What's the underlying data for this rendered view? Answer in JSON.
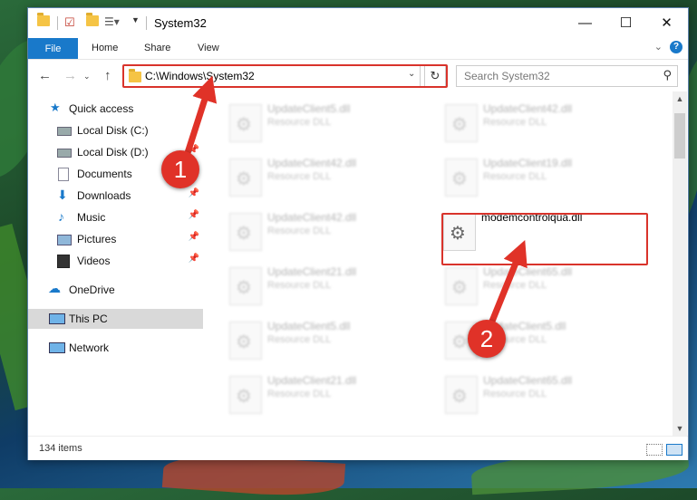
{
  "window": {
    "title": "System32",
    "controls": {
      "minimize": "—",
      "maximize": "☐",
      "close": "✕"
    }
  },
  "ribbon": {
    "tabs": [
      "File",
      "Home",
      "Share",
      "View"
    ],
    "help": "?"
  },
  "address_bar": {
    "path": "C:\\Windows\\System32",
    "search_placeholder": "Search System32"
  },
  "sidebar": {
    "items": [
      {
        "label": "Quick access",
        "icon": "star-icon",
        "pinned": false
      },
      {
        "label": "Local Disk (C:)",
        "icon": "drive-icon",
        "pinned": false
      },
      {
        "label": "Local Disk (D:)",
        "icon": "drive-icon",
        "pinned": true
      },
      {
        "label": "Documents",
        "icon": "documents-icon",
        "pinned": true
      },
      {
        "label": "Downloads",
        "icon": "download-arrow-icon",
        "pinned": true
      },
      {
        "label": "Music",
        "icon": "music-note-icon",
        "pinned": true
      },
      {
        "label": "Pictures",
        "icon": "pictures-icon",
        "pinned": true
      },
      {
        "label": "Videos",
        "icon": "film-icon",
        "pinned": true
      },
      {
        "label": "OneDrive",
        "icon": "cloud-icon",
        "pinned": false
      },
      {
        "label": "This PC",
        "icon": "monitor-icon",
        "pinned": false,
        "selected": true
      },
      {
        "label": "Network",
        "icon": "network-icon",
        "pinned": false
      }
    ]
  },
  "files": [
    {
      "name": "UpdateClient5.dll",
      "type": "Resource DLL"
    },
    {
      "name": "UpdateClient42.dll",
      "type": "Resource DLL"
    },
    {
      "name": "UpdateClient42.dll",
      "type": "Resource DLL"
    },
    {
      "name": "UpdateClient19.dll",
      "type": "Resource DLL"
    },
    {
      "name": "UpdateClient42.dll",
      "type": "Resource DLL"
    },
    {
      "name": "modemcontrolqua.dll",
      "type": ""
    },
    {
      "name": "UpdateClient21.dll",
      "type": "Resource DLL"
    },
    {
      "name": "UpdateClient65.dll",
      "type": "Resource DLL"
    },
    {
      "name": "UpdateClient5.dll",
      "type": "Resource DLL"
    },
    {
      "name": "UpdateClient5.dll",
      "type": "Resource DLL"
    },
    {
      "name": "UpdateClient21.dll",
      "type": "Resource DLL"
    },
    {
      "name": "UpdateClient65.dll",
      "type": "Resource DLL"
    }
  ],
  "status": {
    "item_count": "134 items"
  },
  "callouts": {
    "step1": "1",
    "step2": "2"
  },
  "colors": {
    "accent": "#1979ca",
    "highlight": "#d9332b",
    "callout": "#e03228"
  }
}
